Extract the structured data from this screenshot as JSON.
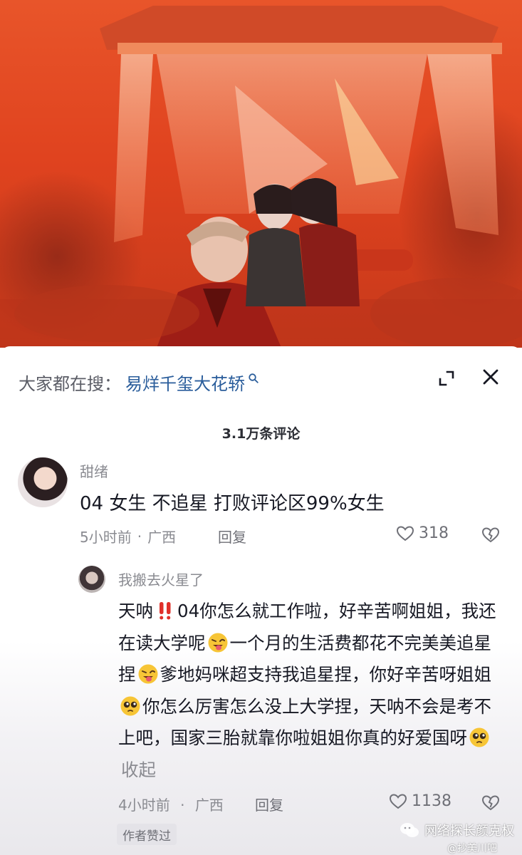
{
  "search": {
    "prefix": "大家都在搜：",
    "term": "易烊千玺大花轿"
  },
  "comments_header": {
    "count_label": "3.1万条评论"
  },
  "comment": {
    "username": "甜绪",
    "text": "04 女生 不追星 打败评论区99%女生",
    "time": "5小时前",
    "separator": "·",
    "location": "广西",
    "reply_label": "回复",
    "likes": "318"
  },
  "reply": {
    "username": "我搬去火星了",
    "text_1": "天呐",
    "text_2": "04你怎么就工作啦，好辛苦啊姐姐，我还在读大学呢",
    "text_3": "一个月的生活费都花不完美美追星捏",
    "text_4": "爹地妈咪超支持我追星捏，你好辛苦呀姐姐",
    "text_5": "你怎么厉害怎么没上大学捏，天呐不会是考不上吧，国家三胎就靠你啦姐姐你真的好爱国呀",
    "collapse_label": "收起",
    "time": "4小时前",
    "separator": "·",
    "location": "广西",
    "reply_label": "回复",
    "likes": "1138",
    "author_liked": "作者赞过"
  },
  "watermark": {
    "text": "网络探长颜克权",
    "sub": "@抄美川吧"
  },
  "icons": {
    "search": "search-icon",
    "expand": "expand-icon",
    "close": "close-icon",
    "heart": "heart-icon",
    "dislike": "broken-heart-icon",
    "double_exclamation": "double-exclamation-emoji",
    "wink": "winking-tongue-emoji",
    "pleading": "pleading-face-emoji"
  },
  "colors": {
    "search_term": "#2a5d9b",
    "muted": "#8a8b91",
    "hero_red": "#e0431f"
  }
}
